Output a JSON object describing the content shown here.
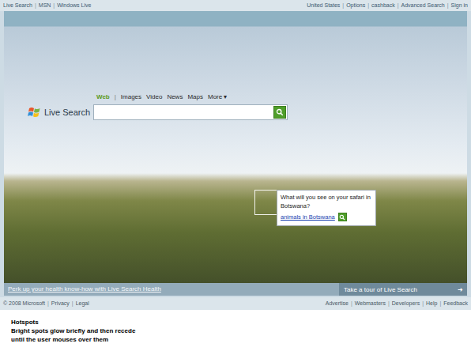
{
  "top_bar": {
    "separator": "|",
    "left_links": [
      "Live Search",
      "MSN",
      "Windows Live"
    ],
    "right_links": [
      "United States",
      "Options",
      "cashback",
      "Advanced Search",
      "Sign in"
    ]
  },
  "search": {
    "logo": "Live Search",
    "tabs_separator": "|",
    "tabs": [
      {
        "label": "Web",
        "selected": true
      },
      {
        "label": "Images",
        "selected": false
      },
      {
        "label": "Video",
        "selected": false
      },
      {
        "label": "News",
        "selected": false
      },
      {
        "label": "Maps",
        "selected": false
      },
      {
        "label": "More ▾",
        "selected": false
      }
    ],
    "query": ""
  },
  "hotspot": {
    "question": "What will you see on your safari in Botswana?",
    "link": "animals in Botswana"
  },
  "promo": {
    "link": "Perk up your health know-how with Live Search Health",
    "tour": "Take a tour of Live Search",
    "tour_arrow": "➜"
  },
  "footer": {
    "separator": "|",
    "left": [
      "© 2008 Microsoft",
      "Privacy",
      "Legal"
    ],
    "right": [
      "Advertise",
      "Webmasters",
      "Developers",
      "Help",
      "Feedback"
    ]
  },
  "caption": {
    "title": "Hotspots",
    "lines": [
      "Bright spots glow briefly and then recede",
      "until the user mouses over them"
    ]
  }
}
